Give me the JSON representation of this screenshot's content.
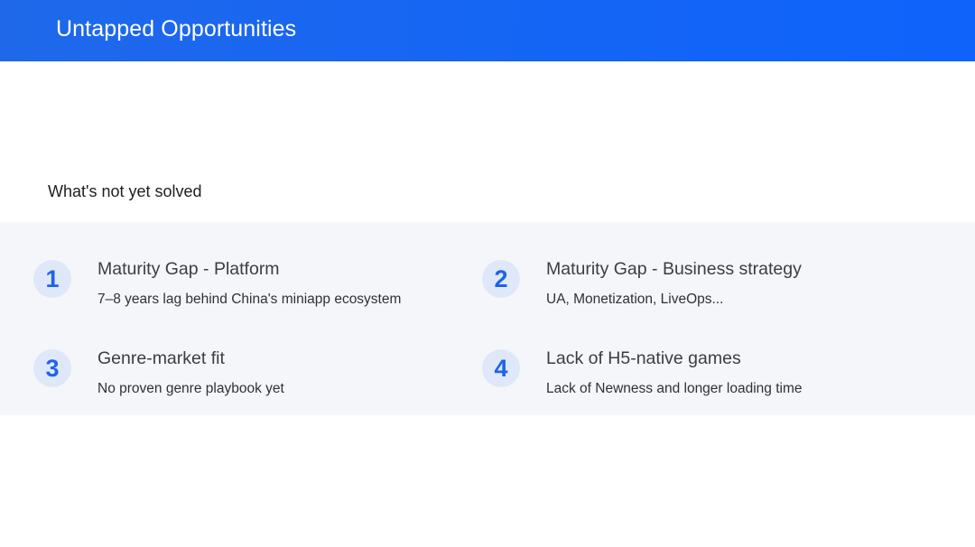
{
  "header": {
    "title": "Untapped Opportunities"
  },
  "section": {
    "subtitle": "What's not yet solved"
  },
  "items": [
    {
      "number": "1",
      "title": "Maturity Gap - Platform",
      "description": "7–8 years lag behind China's miniapp ecosystem"
    },
    {
      "number": "2",
      "title": "Maturity Gap - Business strategy",
      "description": "UA, Monetization, LiveOps..."
    },
    {
      "number": "3",
      "title": "Genre-market fit",
      "description": "No proven genre playbook yet"
    },
    {
      "number": "4",
      "title": "Lack of H5-native games",
      "description": "Lack of Newness and longer loading time"
    }
  ],
  "colors": {
    "header_blue": "#1465f6",
    "badge_bg": "#dfe8f8",
    "badge_text": "#1f63e6",
    "panel_bg": "#f5f6f9"
  }
}
